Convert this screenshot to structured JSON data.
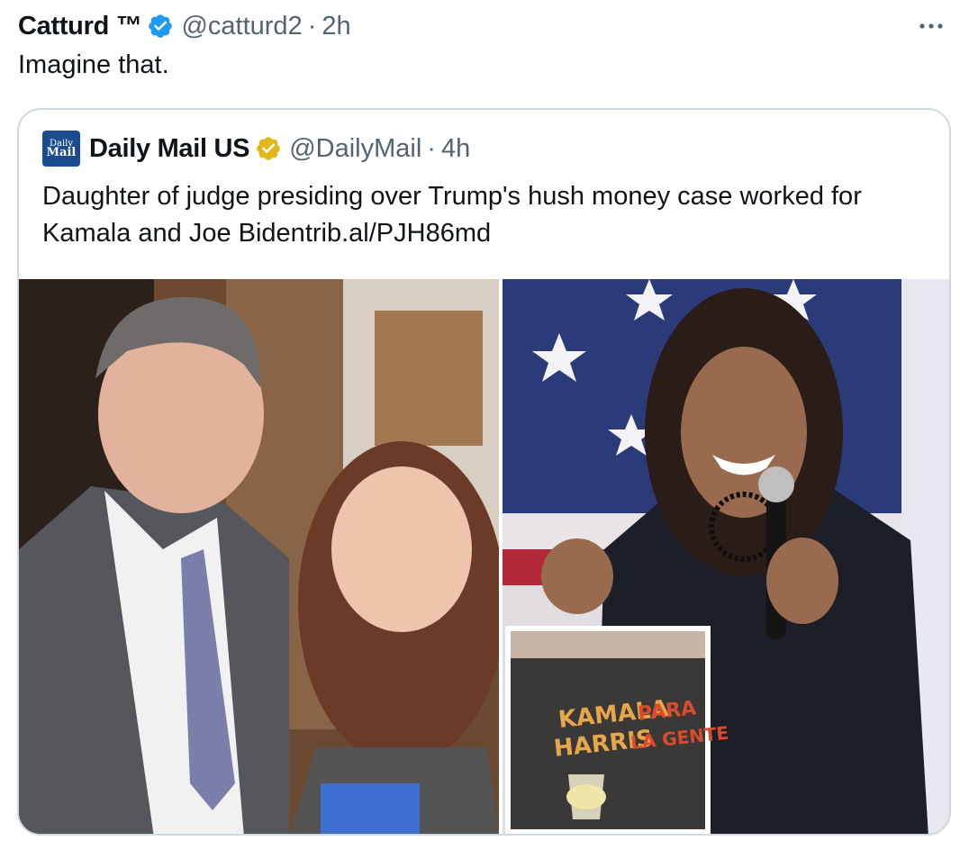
{
  "tweet": {
    "author_name": "Catturd ™",
    "handle": "@catturd2",
    "separator": "·",
    "time": "2h",
    "text": "Imagine that.",
    "more_icon": "more-horizontal-icon",
    "verified_icon": "verified-badge-icon",
    "colors": {
      "verified_blue": "#1d9bf0",
      "secondary_text": "#536471",
      "card_border": "#cfd9de"
    }
  },
  "quote": {
    "avatar_text_top": "Daily",
    "avatar_text_mid": "Mail",
    "author_name": "Daily Mail US",
    "verified_icon": "gold-verified-badge-icon",
    "handle": "@DailyMail",
    "separator": "·",
    "time": "4h",
    "text": "Daughter of judge presiding over Trump's hush money case worked for Kamala and Joe Biden",
    "link": "trib.al/PJH86md",
    "colors": {
      "verified_gold": "#e2b719",
      "avatar_blue": "#1b4c8f"
    },
    "images": [
      {
        "name": "photo-judge-and-daughter"
      },
      {
        "name": "photo-speaker-with-microphone"
      },
      {
        "name": "inset-photo-tshirt",
        "shirt_text_line1": "KAMALA",
        "shirt_text_line2": "HARRIS",
        "shirt_text_line3": "PARA",
        "shirt_text_line4": "LA GENTE"
      }
    ]
  }
}
